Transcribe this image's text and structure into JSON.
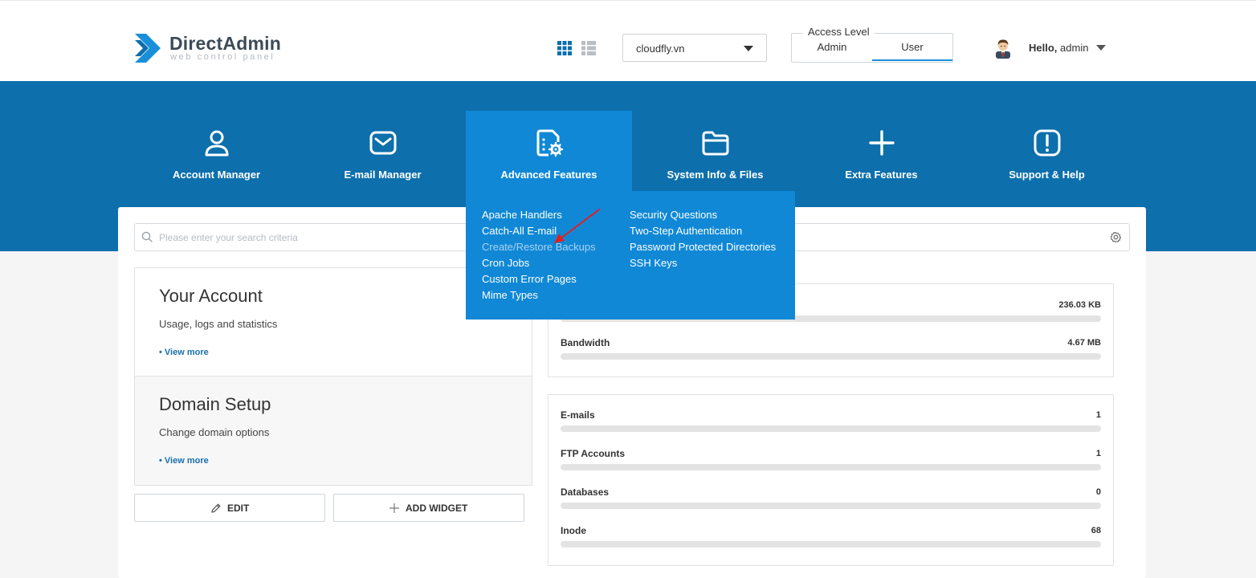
{
  "header": {
    "logo_title": "DirectAdmin",
    "logo_subtitle": "web control panel",
    "domain_select": {
      "value": "cloudfly.vn"
    },
    "access_level": {
      "label": "Access Level",
      "options": [
        "Admin",
        "User"
      ],
      "selected": "User"
    },
    "user": {
      "greeting": "Hello,",
      "name": "admin"
    }
  },
  "nav": {
    "items": [
      {
        "label": "Account Manager",
        "icon": "user-icon"
      },
      {
        "label": "E-mail Manager",
        "icon": "envelope-icon"
      },
      {
        "label": "Advanced Features",
        "icon": "document-gear-icon",
        "active": true
      },
      {
        "label": "System Info & Files",
        "icon": "folder-icon"
      },
      {
        "label": "Extra Features",
        "icon": "plus-icon"
      },
      {
        "label": "Support & Help",
        "icon": "exclamation-icon"
      }
    ]
  },
  "dropdown": {
    "col1": [
      "Apache Handlers",
      "Catch-All E-mail",
      "Create/Restore Backups",
      "Cron Jobs",
      "Custom Error Pages",
      "Mime Types"
    ],
    "col2": [
      "Security Questions",
      "Two-Step Authentication",
      "Password Protected Directories",
      "SSH Keys"
    ],
    "highlighted": "Create/Restore Backups"
  },
  "search": {
    "placeholder": "Please enter your search criteria"
  },
  "panels": [
    {
      "title": "Your Account",
      "subtitle": "Usage, logs and statistics",
      "link": "• View more"
    },
    {
      "title": "Domain Setup",
      "subtitle": "Change domain options",
      "link": "• View more"
    }
  ],
  "buttons": {
    "edit": "EDIT",
    "add_widget": "ADD WIDGET"
  },
  "stats_top": [
    {
      "label": "",
      "value": "236.03 KB"
    },
    {
      "label": "Bandwidth",
      "value": "4.67 MB"
    }
  ],
  "stats_bottom": [
    {
      "label": "E-mails",
      "value": "1"
    },
    {
      "label": "FTP Accounts",
      "value": "1"
    },
    {
      "label": "Databases",
      "value": "0"
    },
    {
      "label": "Inode",
      "value": "68"
    }
  ],
  "colors": {
    "band": "#0d6fac",
    "active_nav": "#1088d6",
    "accent": "#1a8fd9",
    "annotation_arrow": "#e02020"
  }
}
